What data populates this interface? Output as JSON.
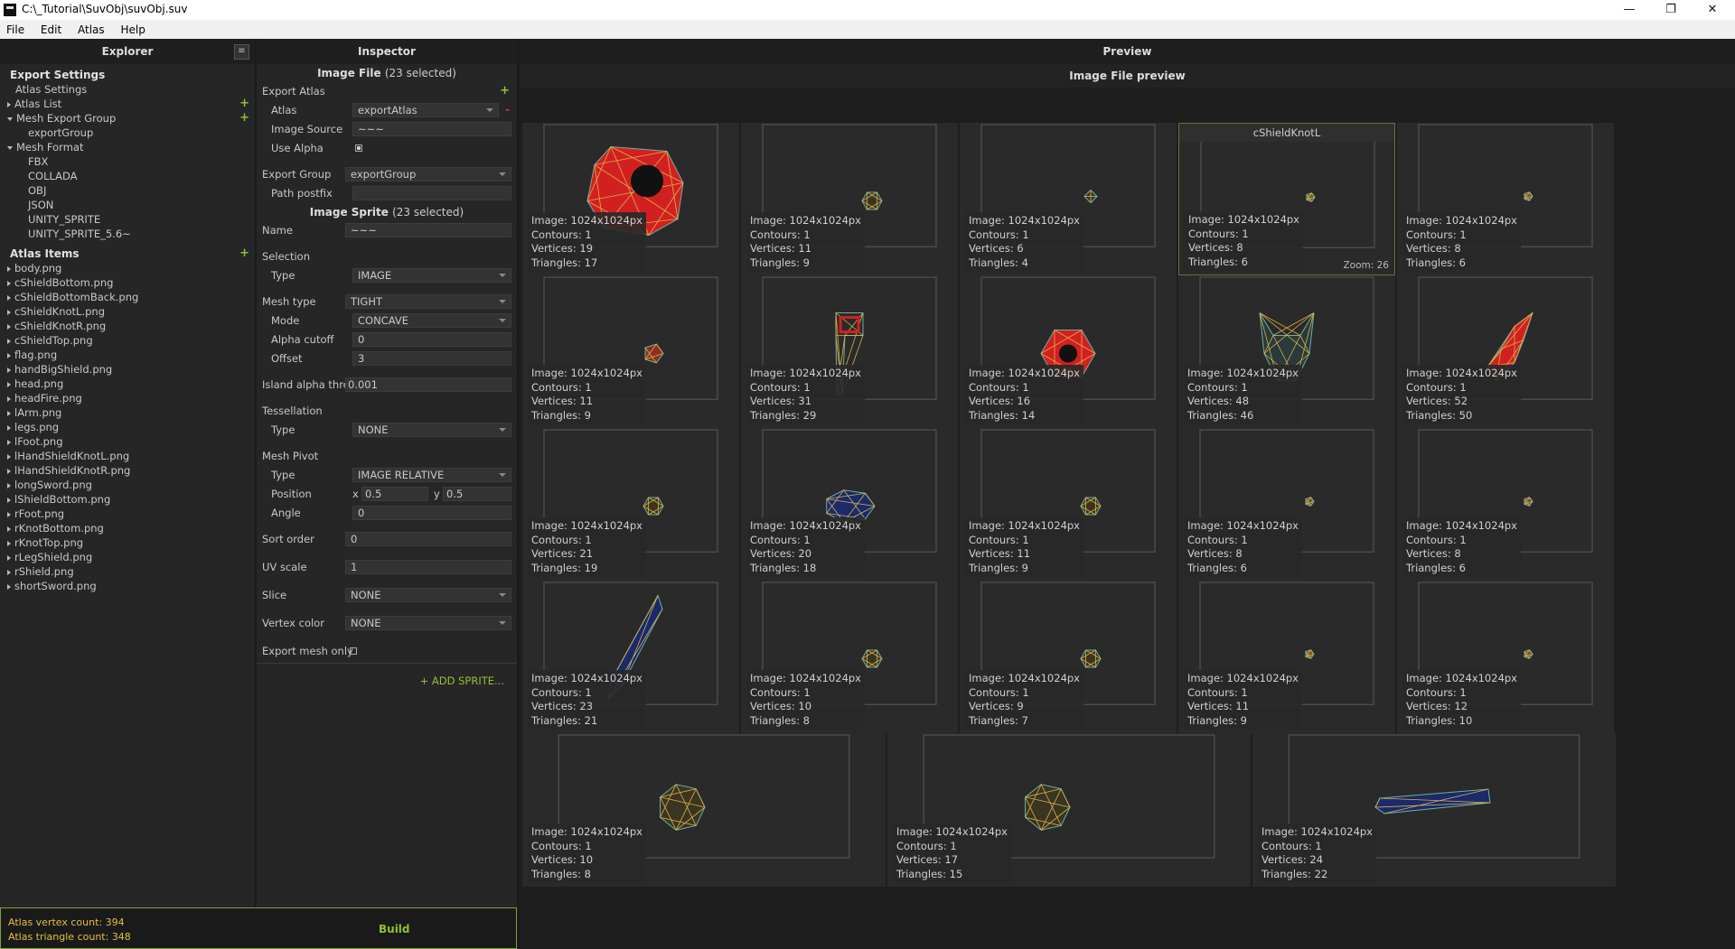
{
  "window": {
    "title": "C:\\_Tutorial\\SuvObj\\suvObj.suv",
    "minimize": "—",
    "restore": "❐",
    "close": "✕"
  },
  "menu": [
    "File",
    "Edit",
    "Atlas",
    "Help"
  ],
  "explorer": {
    "title": "Explorer",
    "menu_icon": "≡",
    "export_settings_title": "Export Settings",
    "items": [
      {
        "label": "Atlas Settings",
        "indent": 1,
        "arrow": "",
        "plus": false
      },
      {
        "label": "Atlas List",
        "indent": 0,
        "arrow": "r",
        "plus": true
      },
      {
        "label": "Mesh Export Group",
        "indent": 0,
        "arrow": "d",
        "plus": true
      },
      {
        "label": "exportGroup",
        "indent": 2,
        "arrow": "",
        "plus": false
      },
      {
        "label": "Mesh Format",
        "indent": 0,
        "arrow": "d",
        "plus": false
      },
      {
        "label": "FBX",
        "indent": 2,
        "arrow": "",
        "plus": false
      },
      {
        "label": "COLLADA",
        "indent": 2,
        "arrow": "",
        "plus": false
      },
      {
        "label": "OBJ",
        "indent": 2,
        "arrow": "",
        "plus": false
      },
      {
        "label": "JSON",
        "indent": 2,
        "arrow": "",
        "plus": false
      },
      {
        "label": "UNITY_SPRITE",
        "indent": 2,
        "arrow": "",
        "plus": false
      },
      {
        "label": "UNITY_SPRITE_5.6~",
        "indent": 2,
        "arrow": "",
        "plus": false
      }
    ],
    "atlas_items_title": "Atlas Items",
    "atlas_items": [
      "body.png",
      "cShieldBottom.png",
      "cShieldBottomBack.png",
      "cShieldKnotL.png",
      "cShieldKnotR.png",
      "cShieldTop.png",
      "flag.png",
      "handBigShield.png",
      "head.png",
      "headFire.png",
      "lArm.png",
      "legs.png",
      "lFoot.png",
      "lHandShieldKnotL.png",
      "lHandShieldKnotR.png",
      "longSword.png",
      "lShieldBottom.png",
      "rFoot.png",
      "rKnotBottom.png",
      "rKnotTop.png",
      "rLegShield.png",
      "rShield.png",
      "shortSword.png"
    ]
  },
  "status": {
    "vertex": "Atlas vertex count: 394",
    "triangle": "Atlas triangle count: 348",
    "build": "Build"
  },
  "inspector": {
    "title": "Inspector",
    "image_file": "Image File",
    "image_file_sel": "(23 selected)",
    "export_atlas": "Export Atlas",
    "atlas_label": "Atlas",
    "atlas_value": "exportAtlas",
    "image_source_label": "Image Source",
    "image_source_value": "~~~",
    "use_alpha_label": "Use Alpha",
    "export_group_label": "Export Group",
    "export_group_value": "exportGroup",
    "path_postfix_label": "Path postfix",
    "path_postfix_value": "",
    "image_sprite": "Image Sprite",
    "image_sprite_sel": "(23 selected)",
    "name_label": "Name",
    "name_value": "~~~",
    "selection_label": "Selection",
    "type_label": "Type",
    "selection_type": "IMAGE",
    "mesh_type_label": "Mesh type",
    "mesh_type_value": "TIGHT",
    "mode_label": "Mode",
    "mode_value": "CONCAVE",
    "alpha_cutoff_label": "Alpha cutoff",
    "alpha_cutoff_value": "0",
    "offset_label": "Offset",
    "offset_value": "3",
    "island_label": "Island alpha thre",
    "island_value": "0.001",
    "tess_label": "Tessellation",
    "tess_type": "NONE",
    "pivot_label": "Mesh Pivot",
    "pivot_type": "IMAGE RELATIVE",
    "position_label": "Position",
    "x_label": "x",
    "x_value": "0.5",
    "y_label": "y",
    "y_value": "0.5",
    "angle_label": "Angle",
    "angle_value": "0",
    "sort_label": "Sort order",
    "sort_value": "0",
    "uv_label": "UV scale",
    "uv_value": "1",
    "slice_label": "Slice",
    "slice_value": "NONE",
    "vcolor_label": "Vertex color",
    "vcolor_value": "NONE",
    "export_mesh_label": "Export mesh only",
    "add_sprite": "+ ADD SPRITE..."
  },
  "preview": {
    "title": "Preview",
    "subtitle": "Image File preview",
    "hover_title": "cShieldKnotL",
    "zoom": "Zoom: 26",
    "tiles": [
      {
        "image": "Image: 1024x1024px",
        "contours": "Contours: 1",
        "vertices": "Vertices: 19",
        "triangles": "Triangles: 17",
        "shape": "red-shield"
      },
      {
        "image": "Image: 1024x1024px",
        "contours": "Contours: 1",
        "vertices": "Vertices: 11",
        "triangles": "Triangles: 9",
        "shape": "small-gold"
      },
      {
        "image": "Image: 1024x1024px",
        "contours": "Contours: 1",
        "vertices": "Vertices: 6",
        "triangles": "Triangles: 4",
        "shape": "tiny-gold"
      },
      {
        "image": "Image: 1024x1024px",
        "contours": "Contours: 1",
        "vertices": "Vertices: 8",
        "triangles": "Triangles: 6",
        "shape": "dot-gold"
      },
      {
        "image": "Image: 1024x1024px",
        "contours": "Contours: 1",
        "vertices": "Vertices: 8",
        "triangles": "Triangles: 6",
        "shape": "dot-gold"
      },
      {
        "image": "Image: 1024x1024px",
        "contours": "Contours: 1",
        "vertices": "Vertices: 11",
        "triangles": "Triangles: 9",
        "shape": "small-red"
      },
      {
        "image": "Image: 1024x1024px",
        "contours": "Contours: 1",
        "vertices": "Vertices: 31",
        "triangles": "Triangles: 29",
        "shape": "flag"
      },
      {
        "image": "Image: 1024x1024px",
        "contours": "Contours: 1",
        "vertices": "Vertices: 16",
        "triangles": "Triangles: 14",
        "shape": "red-diamond"
      },
      {
        "image": "Image: 1024x1024px",
        "contours": "Contours: 1",
        "vertices": "Vertices: 48",
        "triangles": "Triangles: 46",
        "shape": "horns"
      },
      {
        "image": "Image: 1024x1024px",
        "contours": "Contours: 1",
        "vertices": "Vertices: 52",
        "triangles": "Triangles: 50",
        "shape": "fire"
      },
      {
        "image": "Image: 1024x1024px",
        "contours": "Contours: 1",
        "vertices": "Vertices: 21",
        "triangles": "Triangles: 19",
        "shape": "small-gold"
      },
      {
        "image": "Image: 1024x1024px",
        "contours": "Contours: 1",
        "vertices": "Vertices: 20",
        "triangles": "Triangles: 18",
        "shape": "blue-blob"
      },
      {
        "image": "Image: 1024x1024px",
        "contours": "Contours: 1",
        "vertices": "Vertices: 11",
        "triangles": "Triangles: 9",
        "shape": "small-gold"
      },
      {
        "image": "Image: 1024x1024px",
        "contours": "Contours: 1",
        "vertices": "Vertices: 8",
        "triangles": "Triangles: 6",
        "shape": "dot-gold"
      },
      {
        "image": "Image: 1024x1024px",
        "contours": "Contours: 1",
        "vertices": "Vertices: 8",
        "triangles": "Triangles: 6",
        "shape": "dot-gold"
      },
      {
        "image": "Image: 1024x1024px",
        "contours": "Contours: 1",
        "vertices": "Vertices: 23",
        "triangles": "Triangles: 21",
        "shape": "sword"
      },
      {
        "image": "Image: 1024x1024px",
        "contours": "Contours: 1",
        "vertices": "Vertices: 10",
        "triangles": "Triangles: 8",
        "shape": "small-gold"
      },
      {
        "image": "Image: 1024x1024px",
        "contours": "Contours: 1",
        "vertices": "Vertices: 9",
        "triangles": "Triangles: 7",
        "shape": "small-gold"
      },
      {
        "image": "Image: 1024x1024px",
        "contours": "Contours: 1",
        "vertices": "Vertices: 11",
        "triangles": "Triangles: 9",
        "shape": "dot-gold"
      },
      {
        "image": "Image: 1024x1024px",
        "contours": "Contours: 1",
        "vertices": "Vertices: 12",
        "triangles": "Triangles: 10",
        "shape": "dot-gold"
      },
      {
        "image": "Image: 1024x1024px",
        "contours": "Contours: 1",
        "vertices": "Vertices: 10",
        "triangles": "Triangles: 8",
        "shape": "knot"
      },
      {
        "image": "Image: 1024x1024px",
        "contours": "Contours: 1",
        "vertices": "Vertices: 17",
        "triangles": "Triangles: 15",
        "shape": "knot"
      },
      {
        "image": "Image: 1024x1024px",
        "contours": "Contours: 1",
        "vertices": "Vertices: 24",
        "triangles": "Triangles: 22",
        "shape": "long-sword"
      }
    ]
  },
  "colors": {
    "accent": "#8fc234",
    "mesh_red": "#d22020",
    "mesh_gold": "#d8b050",
    "mesh_blue": "#1a2a6a"
  }
}
